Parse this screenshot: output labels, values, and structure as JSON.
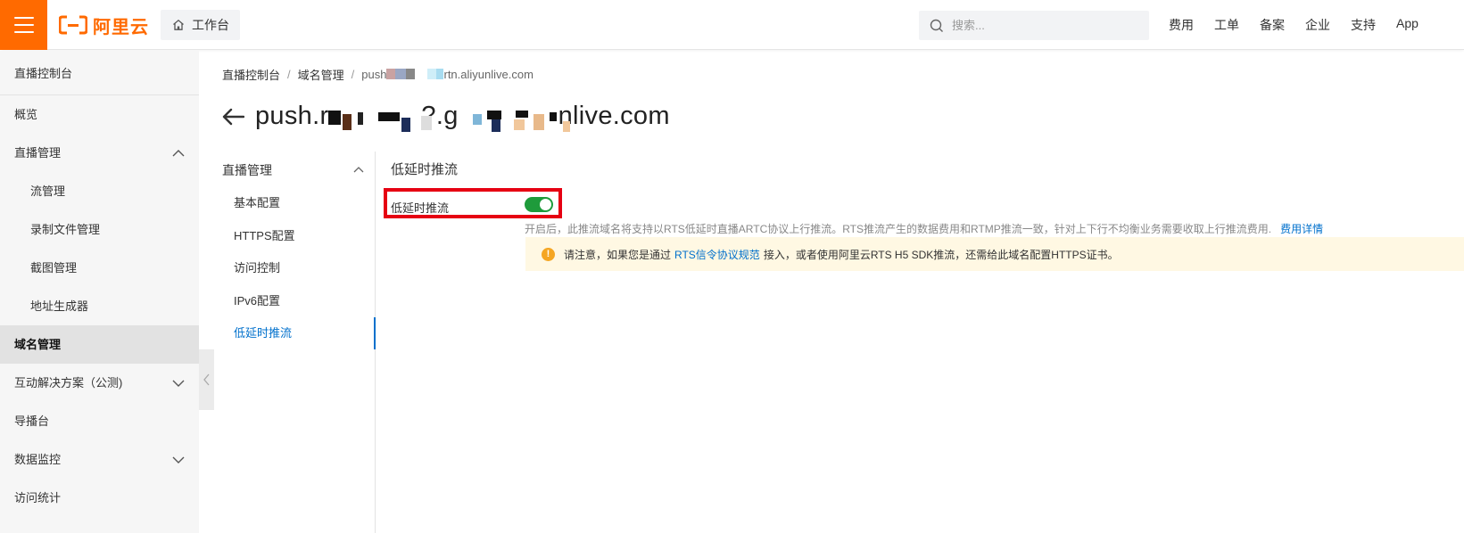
{
  "colors": {
    "brand": "#ff6a00",
    "link": "#0070cc",
    "switch_on": "#1e9b3b",
    "highlight_border": "#e60012",
    "notice_bg": "#fff8e3"
  },
  "header": {
    "logo_text": "阿里云",
    "workbench_label": "工作台",
    "search_placeholder": "搜索...",
    "links": [
      "费用",
      "工单",
      "备案",
      "企业",
      "支持",
      "App"
    ]
  },
  "sidebar": {
    "title": "直播控制台",
    "items": [
      {
        "label": "概览",
        "level": 1
      },
      {
        "label": "直播管理",
        "level": 1,
        "chevron": "up"
      },
      {
        "label": "流管理",
        "level": 2
      },
      {
        "label": "录制文件管理",
        "level": 2
      },
      {
        "label": "截图管理",
        "level": 2
      },
      {
        "label": "地址生成器",
        "level": 2
      },
      {
        "label": "域名管理",
        "level": 1,
        "active": true
      },
      {
        "label": "互动解决方案（公测)",
        "level": 1,
        "chevron": "down"
      },
      {
        "label": "导播台",
        "level": 1
      },
      {
        "label": "数据监控",
        "level": 1,
        "chevron": "down"
      },
      {
        "label": "访问统计",
        "level": 1
      }
    ]
  },
  "breadcrumb": {
    "items": [
      "直播控制台",
      "域名管理"
    ],
    "current_prefix": "push",
    "current_suffix": "rtn.aliyunlive.com",
    "separator": "/"
  },
  "page_title": {
    "prefix": "push.r",
    "middle": "?.g",
    "suffix": "nlive.com"
  },
  "subnav": {
    "header": "直播管理",
    "items": [
      {
        "label": "基本配置"
      },
      {
        "label": "HTTPS配置"
      },
      {
        "label": "访问控制"
      },
      {
        "label": "IPv6配置"
      },
      {
        "label": "低延时推流",
        "active": true
      }
    ]
  },
  "content": {
    "section_title": "低延时推流",
    "toggle_label": "低延时推流",
    "toggle_on": true,
    "description": "开启后，此推流域名将支持以RTS低延时直播ARTC协议上行推流。RTS推流产生的数据费用和RTMP推流一致，针对上下行不均衡业务需要收取上行推流费用.",
    "description_link": "费用详情",
    "notice_prefix": "请注意，如果您是通过",
    "notice_link": "RTS信令协议规范",
    "notice_suffix": "接入，或者使用阿里云RTS H5 SDK推流，还需给此域名配置HTTPS证书。"
  }
}
